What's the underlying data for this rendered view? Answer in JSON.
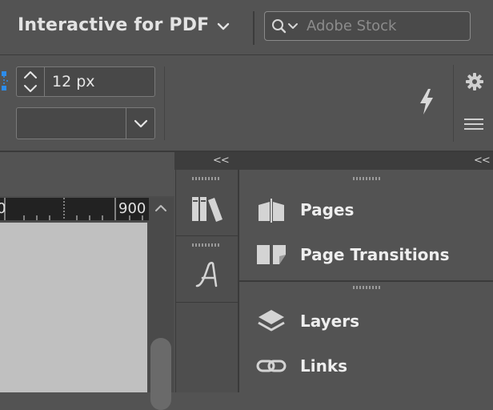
{
  "header": {
    "workspace_title": "Interactive for PDF",
    "search_placeholder": "Adobe Stock"
  },
  "controlbar": {
    "stepper_value": "12 px",
    "dropdown_value": ""
  },
  "ruler": {
    "labels": [
      "0",
      "900"
    ]
  },
  "panels": {
    "group1": [
      {
        "label": "Pages",
        "icon": "pages-icon"
      },
      {
        "label": "Page Transitions",
        "icon": "page-transitions-icon"
      }
    ],
    "group2": [
      {
        "label": "Layers",
        "icon": "layers-icon"
      },
      {
        "label": "Links",
        "icon": "links-icon"
      }
    ]
  },
  "dock": {
    "icons": [
      "libraries-icon",
      "character-styles-icon"
    ]
  },
  "collapse_label": "<<",
  "colors": {
    "background": "#535353",
    "ruler": "#222222",
    "canvas": "#c0c0c0",
    "accent_blue": "#2d8ceb"
  }
}
